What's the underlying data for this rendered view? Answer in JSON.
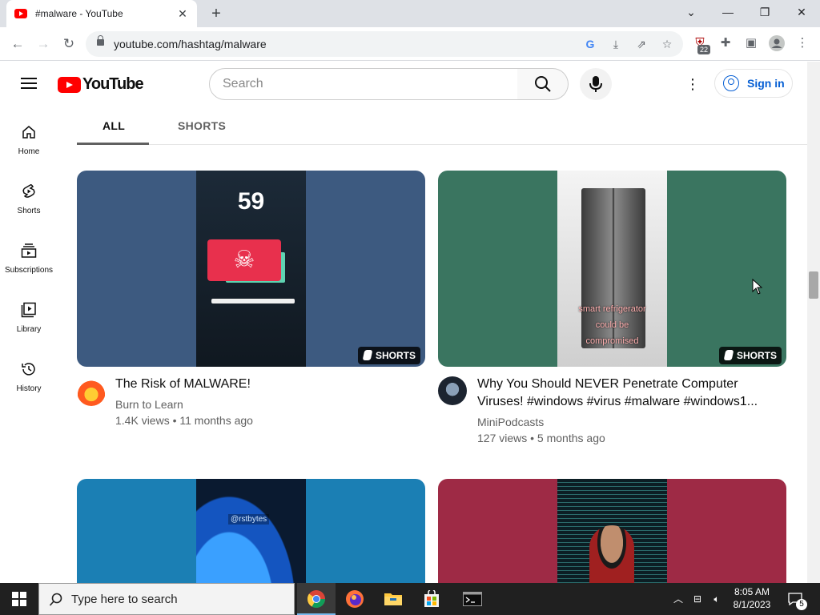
{
  "browser": {
    "tab_title": "#malware - YouTube",
    "new_tab_glyph": "+",
    "url": "youtube.com/hashtag/malware",
    "extension_badge": "22",
    "window_controls": [
      "minimize-icon",
      "restore-icon",
      "close-icon"
    ]
  },
  "youtube": {
    "logo_text": "YouTube",
    "search_placeholder": "Search",
    "sign_in_label": "Sign in",
    "brand_color": "#ff0000",
    "link_color": "#065fd4"
  },
  "sidebar": {
    "items": [
      {
        "label": "Home",
        "icon": "home-icon"
      },
      {
        "label": "Shorts",
        "icon": "shorts-icon"
      },
      {
        "label": "Subscriptions",
        "icon": "subscriptions-icon"
      },
      {
        "label": "Library",
        "icon": "library-icon"
      },
      {
        "label": "History",
        "icon": "history-icon"
      }
    ]
  },
  "tabs": [
    {
      "label": "ALL",
      "active": true
    },
    {
      "label": "SHORTS",
      "active": false
    }
  ],
  "videos": [
    {
      "title": "The Risk of MALWARE!",
      "channel": "Burn to Learn",
      "meta": "1.4K views • 11 months ago",
      "badge": "SHORTS",
      "thumb_text": "59",
      "bg_color": "#3d5a80"
    },
    {
      "title_line1": "Why You Should NEVER Penetrate Computer",
      "title_line2": "Viruses! #windows #virus #malware #windows1...",
      "channel": "MiniPodcasts",
      "meta": "127 views • 5 months ago",
      "badge": "SHORTS",
      "thumb_caption_1": "smart refrigerator",
      "thumb_caption_2": "could be",
      "thumb_caption_3": "compromised",
      "bg_color": "#3a7560"
    },
    {
      "thumb_text": "@rstbytes",
      "bg_color": "#1b7fb4"
    },
    {
      "bg_color": "#9e2a45"
    }
  ],
  "taskbar": {
    "search_placeholder": "Type here to search",
    "time": "8:05 AM",
    "date": "8/1/2023",
    "notification_count": "5"
  }
}
